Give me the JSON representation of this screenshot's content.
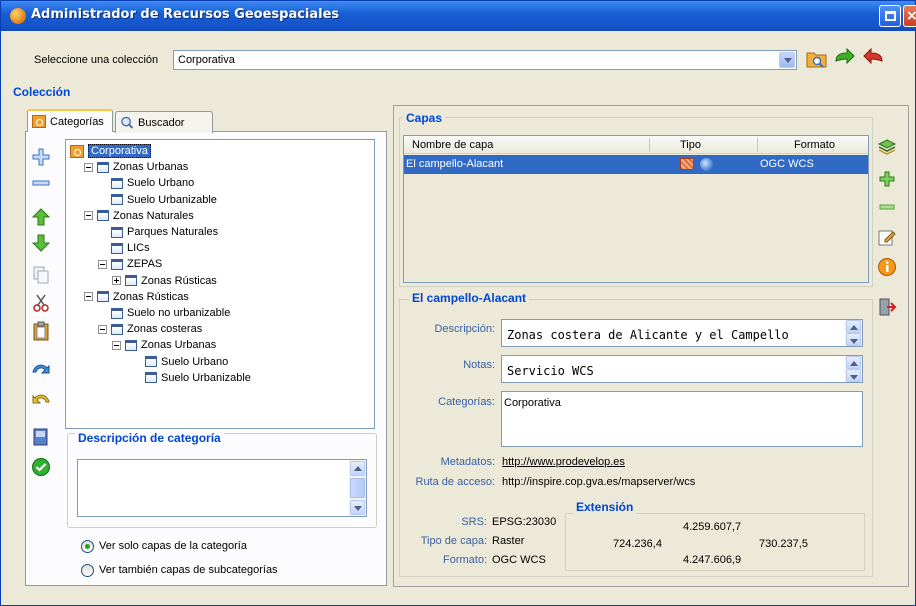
{
  "window": {
    "title": "Administrador de Recursos Geoespaciales"
  },
  "collection_select": {
    "label": "Seleccione una colección",
    "value": "Corporativa"
  },
  "sections": {
    "coleccion": "Colección",
    "capas": "Capas",
    "descripcion_categoria": "Descripción de categoría",
    "extension": "Extensión"
  },
  "tabs": [
    {
      "label": "Categorías",
      "active": true
    },
    {
      "label": "Buscador",
      "active": false
    }
  ],
  "tree": [
    {
      "label": "Corporativa",
      "level": 0,
      "selected": true
    },
    {
      "label": "Zonas Urbanas",
      "level": 1,
      "expander": "minus"
    },
    {
      "label": "Suelo Urbano",
      "level": 2
    },
    {
      "label": "Suelo Urbanizable",
      "level": 2
    },
    {
      "label": "Zonas Naturales",
      "level": 1,
      "expander": "minus"
    },
    {
      "label": "Parques Naturales",
      "level": 2
    },
    {
      "label": "LICs",
      "level": 2
    },
    {
      "label": "ZEPAS",
      "level": 2,
      "expander": "minus"
    },
    {
      "label": "Zonas Rústicas",
      "level": 3,
      "expander": "plus"
    },
    {
      "label": "Zonas Rústicas",
      "level": 1,
      "expander": "minus"
    },
    {
      "label": "Suelo no urbanizable",
      "level": 2
    },
    {
      "label": "Zonas costeras",
      "level": 2,
      "expander": "minus"
    },
    {
      "label": "Zonas Urbanas",
      "level": 3,
      "expander": "minus"
    },
    {
      "label": "Suelo Urbano",
      "level": 4
    },
    {
      "label": "Suelo Urbanizable",
      "level": 4
    }
  ],
  "radios": [
    {
      "label": "Ver solo capas de la categoría",
      "checked": true
    },
    {
      "label": "Ver también capas de subcategorías",
      "checked": false
    }
  ],
  "capas_table": {
    "headers": [
      "Nombre de capa",
      "Tipo",
      "Formato"
    ],
    "rows": [
      {
        "nombre": "El campello-Alacant",
        "formato": "OGC WCS",
        "selected": true
      }
    ]
  },
  "detail": {
    "title": "El campello-Alacant",
    "descripcion_label": "Descripción:",
    "descripcion": "Zonas costera de Alicante y el Campello",
    "notas_label": "Notas:",
    "notas": "Servicio WCS",
    "categorias_label": "Categorías:",
    "categorias": "Corporativa",
    "metadatos_label": "Metadatos:",
    "metadatos": "http://www.prodevelop.es",
    "ruta_label": "Ruta de acceso:",
    "ruta": "http://inspire.cop.gva.es/mapserver/wcs",
    "srs_label": "SRS:",
    "srs": "EPSG:23030",
    "tipo_label": "Tipo de capa:",
    "tipo": "Raster",
    "formato_label": "Formato:",
    "formato": "OGC WCS",
    "ext_top": "4.259.607,7",
    "ext_left": "724.236,4",
    "ext_right": "730.237,5",
    "ext_bottom": "4.247.606,9"
  },
  "colors": {
    "accent": "#0046d5",
    "selection": "#316ac5",
    "titlebar": "#1553c9"
  }
}
